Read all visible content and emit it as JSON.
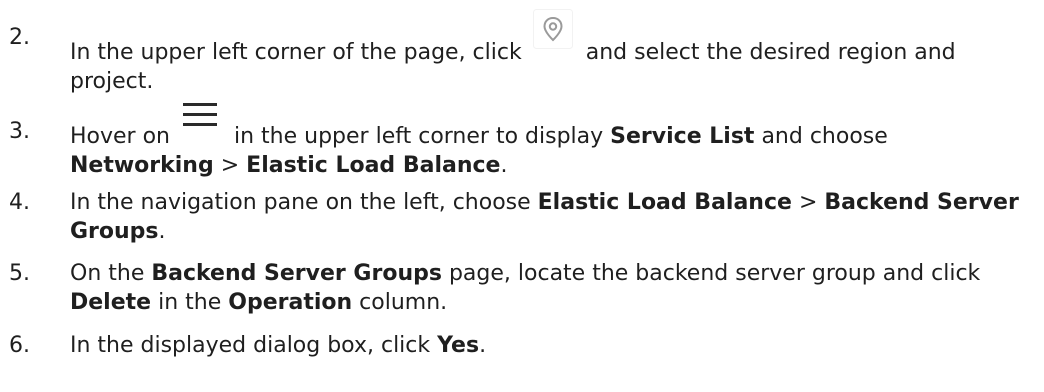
{
  "steps": [
    {
      "number": "2.",
      "text_before": "In the upper left corner of the page, click",
      "icon": "location-pin-icon",
      "text_after": "and select the desired region and project."
    },
    {
      "number": "3.",
      "text_before": "Hover on",
      "icon": "hamburger-menu-icon",
      "text_mid": "in the upper left corner to display",
      "bold1": "Service List",
      "text_mid2": "and choose",
      "bold2": "Networking",
      "sep": ">",
      "bold3": "Elastic Load Balance",
      "end": "."
    },
    {
      "number": "4.",
      "text_before": "In the navigation pane on the left, choose",
      "bold1": "Elastic Load Balance",
      "sep": ">",
      "bold2": "Backend Server Groups",
      "end": "."
    },
    {
      "number": "5.",
      "text_before": "On the",
      "bold1": "Backend Server Groups",
      "text_mid": "page, locate the backend server group and click",
      "bold2": "Delete",
      "text_mid2": "in the",
      "bold3": "Operation",
      "end": "column."
    },
    {
      "number": "6.",
      "text_before": "In the displayed dialog box, click",
      "bold1": "Yes",
      "end": "."
    }
  ],
  "colors": {
    "text": "#1f1f1f",
    "icon_gray": "#9a9a9a",
    "menu_icon": "#2a2a2a"
  }
}
